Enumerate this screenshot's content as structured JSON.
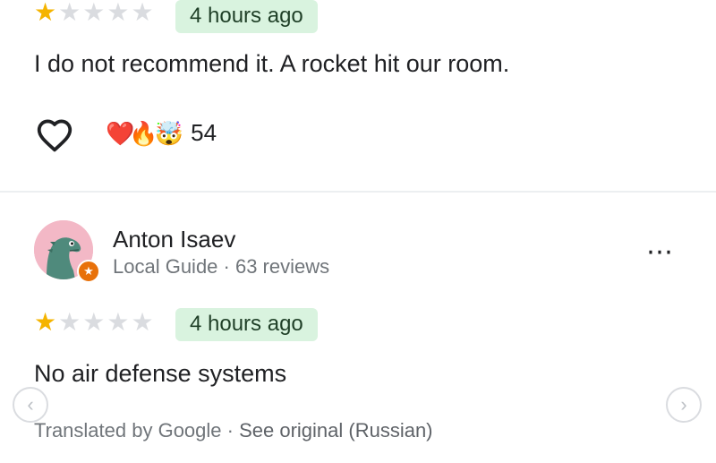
{
  "review1": {
    "rating_stars": 1,
    "rating_max": 5,
    "time": "4 hours ago",
    "text": "I do not recommend it. A rocket hit our room.",
    "reactions": [
      "❤️",
      "🔥",
      "🤯"
    ],
    "reaction_count": "54"
  },
  "review2": {
    "author_name": "Anton Isaev",
    "author_meta": "Local Guide · 63 reviews",
    "rating_stars": 1,
    "rating_max": 5,
    "time": "4 hours ago",
    "text": "No air defense systems",
    "translated_label": "Translated by Google · ",
    "see_original": "See original (Russian)",
    "more_icon": "⋯"
  },
  "icons": {
    "star": "★",
    "heart": "heart-outline-icon",
    "left_arrow": "‹",
    "right_arrow": "›"
  },
  "colors": {
    "star_filled": "#f5b400",
    "star_empty": "#dadce0",
    "badge_bg": "#d9f3df",
    "guide_orange": "#e8710a"
  }
}
